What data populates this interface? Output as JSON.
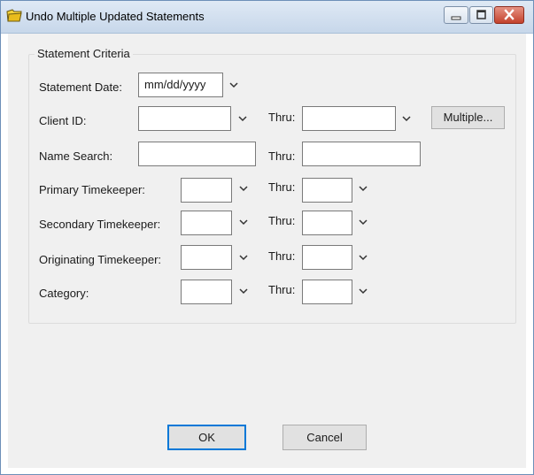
{
  "window": {
    "title": "Undo Multiple Updated Statements"
  },
  "group": {
    "legend": "Statement Criteria"
  },
  "fields": {
    "statement_date_label": "Statement Date:",
    "statement_date_value": "mm/dd/yyyy",
    "client_id_label": "Client ID:",
    "client_id_value": "",
    "client_thru_label": "Thru:",
    "client_thru_value": "",
    "multiple_button": "Multiple...",
    "name_search_label": "Name Search:",
    "name_search_value": "",
    "name_thru_label": "Thru:",
    "name_thru_value": "",
    "primary_tk_label": "Primary Timekeeper:",
    "primary_tk_value": "",
    "primary_thru_label": "Thru:",
    "primary_thru_value": "",
    "secondary_tk_label": "Secondary Timekeeper:",
    "secondary_tk_value": "",
    "secondary_thru_label": "Thru:",
    "secondary_thru_value": "",
    "originating_tk_label": "Originating Timekeeper:",
    "originating_tk_value": "",
    "originating_thru_label": "Thru:",
    "originating_thru_value": "",
    "category_label": "Category:",
    "category_value": "",
    "category_thru_label": "Thru:",
    "category_thru_value": ""
  },
  "buttons": {
    "ok": "OK",
    "cancel": "Cancel"
  },
  "icons": {
    "app": "folder-icon",
    "minimize": "minimize-icon",
    "maximize": "maximize-icon",
    "close": "close-icon",
    "dropdown": "chevron-down-icon"
  },
  "colors": {
    "title_gradient_top": "#dfe9f5",
    "close_button": "#c3412c",
    "default_button_border": "#0078d7",
    "dialog_background": "#f0f0f0"
  }
}
